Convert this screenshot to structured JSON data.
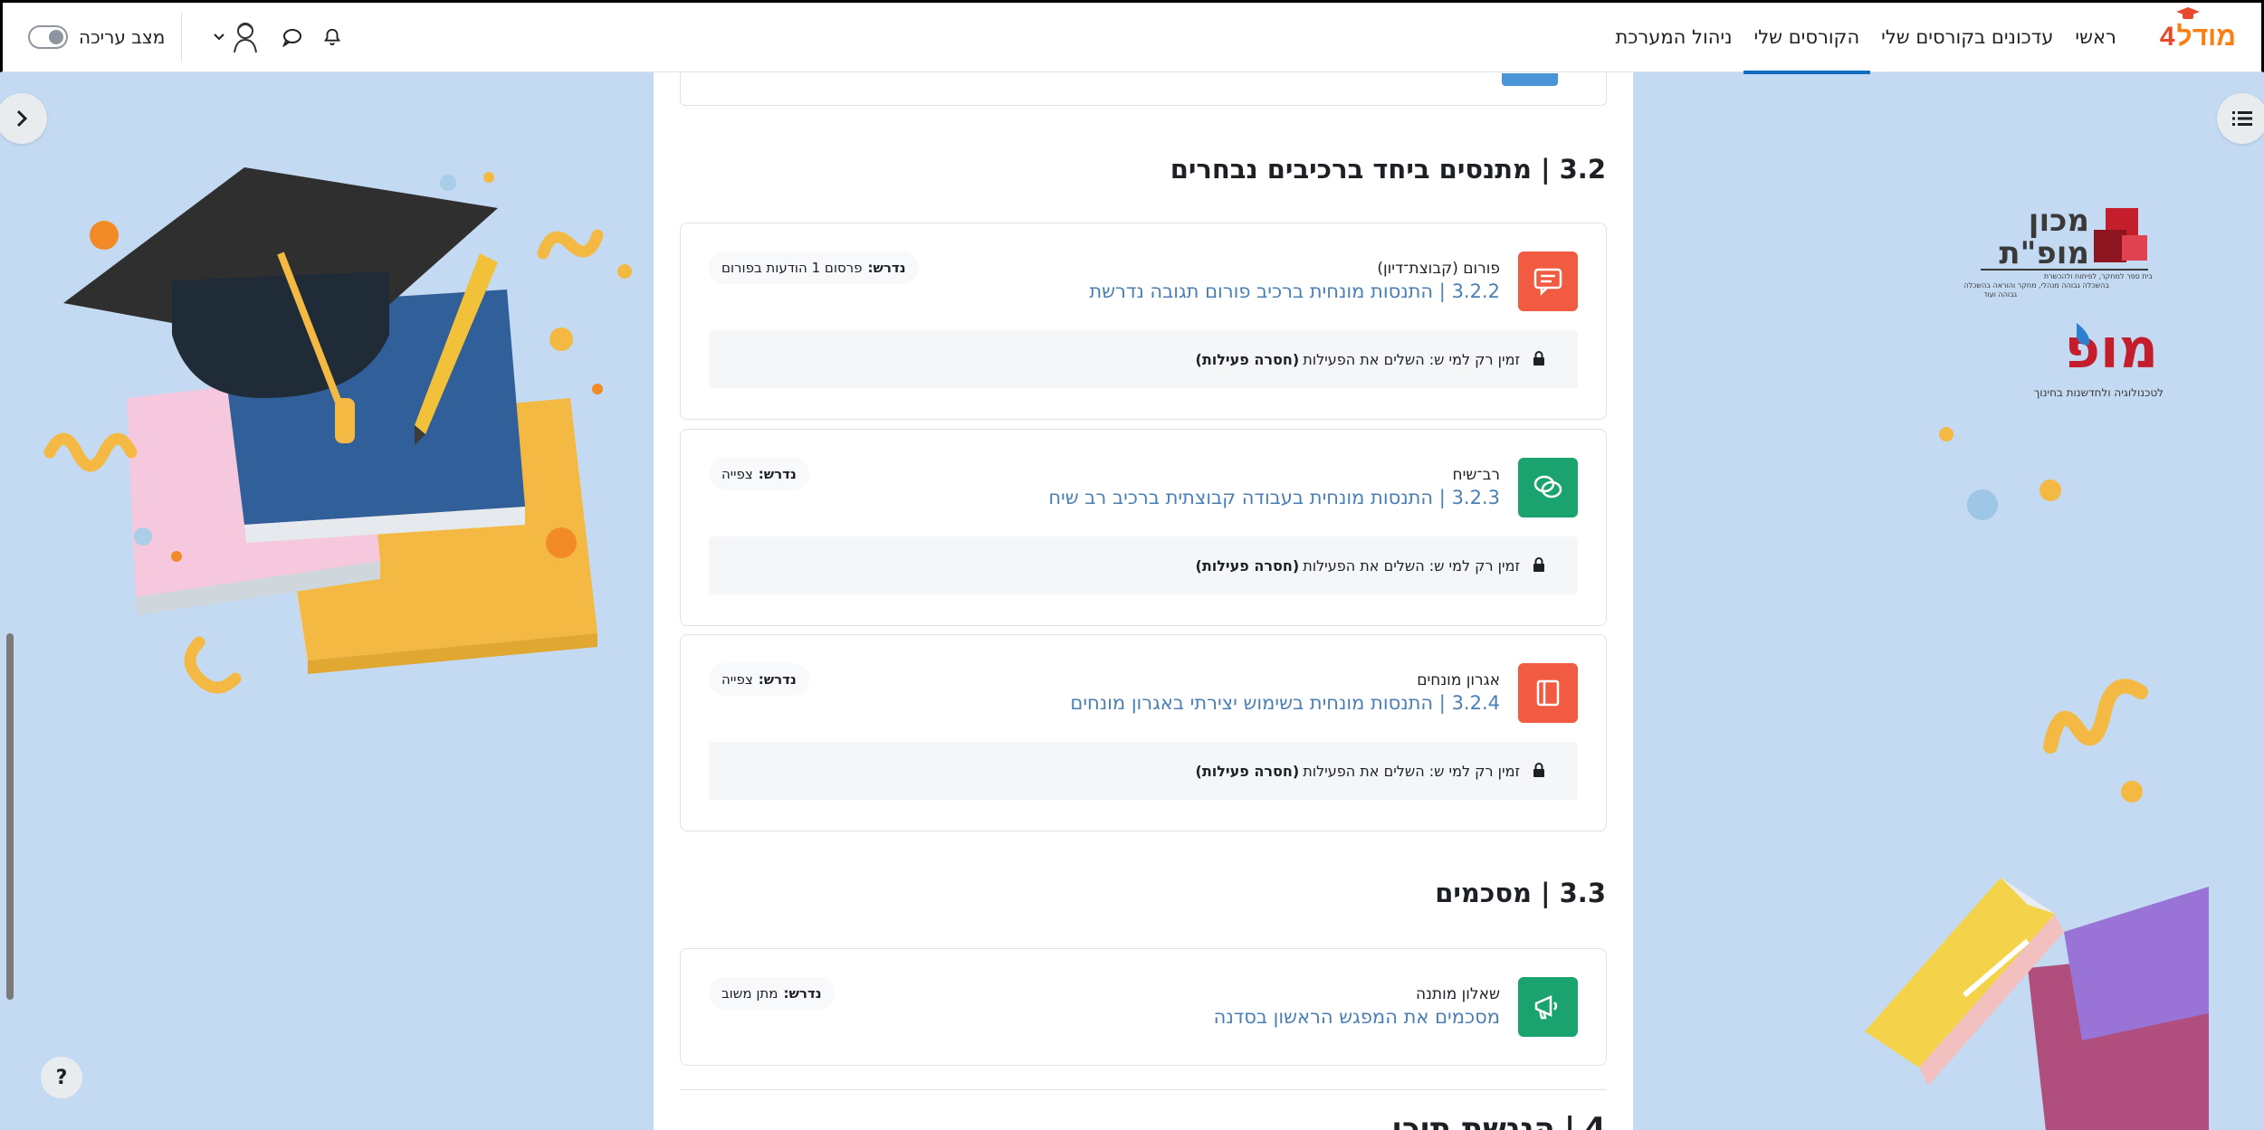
{
  "navbar": {
    "brand_name": "מודל",
    "brand_number": "4",
    "nav_items": [
      {
        "label": "ראשי",
        "active": false
      },
      {
        "label": "עדכונים בקורסים שלי",
        "active": false
      },
      {
        "label": "הקורסים שלי",
        "active": true
      },
      {
        "label": "ניהול המערכת",
        "active": false
      }
    ],
    "edit_mode_label": "מצב עריכה",
    "edit_mode_on": false,
    "icons": [
      "bell-icon",
      "chat-icon",
      "user-avatar",
      "chevron-down-icon"
    ]
  },
  "logos": {
    "mofet_name": "מכון מופ\"ת",
    "mofet_subtitle_1": "בית ספר למחקר, לפיתוח ולהכשרת",
    "mofet_subtitle_2": "בהשכלה גבוהה מנהלי, מחקר והוראה בהשכלה",
    "mofet_subtitle_3": "גבוהה ועוד",
    "mop_name": "מופ",
    "mop_subtitle": "לטכנולוגיה ולחדשנות בחינוך"
  },
  "sections": [
    {
      "number": "3.2",
      "title": "מתנסים ביחד ברכיבים נבחרים"
    },
    {
      "number": "3.3",
      "title": "מסכמים"
    },
    {
      "number": "4",
      "title": "הנגשת תוכן"
    }
  ],
  "activities": [
    {
      "type": "פורום (קבוצת־דיון)",
      "title": "3.2.2 | התנסות מונחית ברכיב פורום תגובה נדרשת",
      "badge_label": "נדרש:",
      "badge_value": "פרסום 1 הודעות בפורום",
      "restriction_text": "זמין רק למי ש: השלים את הפעילות",
      "restriction_bold": "(חסרה פעילות)",
      "icon": "forum-icon",
      "color": "#f05b41"
    },
    {
      "type": "רב־שיח",
      "title": "3.2.3 | התנסות מונחית בעבודה קבוצתית ברכיב רב שיח",
      "badge_label": "נדרש:",
      "badge_value": "צפייה",
      "restriction_text": "זמין רק למי ש: השלים את הפעילות",
      "restriction_bold": "(חסרה פעילות)",
      "icon": "chat-icon",
      "color": "#1aa36e"
    },
    {
      "type": "אגרון מונחים",
      "title": "3.2.4 | התנסות מונחית בשימוש יצירתי באגרון מונחים",
      "badge_label": "נדרש:",
      "badge_value": "צפייה",
      "restriction_text": "זמין רק למי ש: השלים את הפעילות",
      "restriction_bold": "(חסרה פעילות)",
      "icon": "book-icon",
      "color": "#f05b41"
    },
    {
      "type": "שאלון מותנה",
      "title": "מסכמים את המפגש הראשון בסדנה",
      "badge_label": "נדרש:",
      "badge_value": "מתן משוב",
      "icon": "megaphone-icon",
      "color": "#1aa36e"
    }
  ],
  "help_label": "?"
}
